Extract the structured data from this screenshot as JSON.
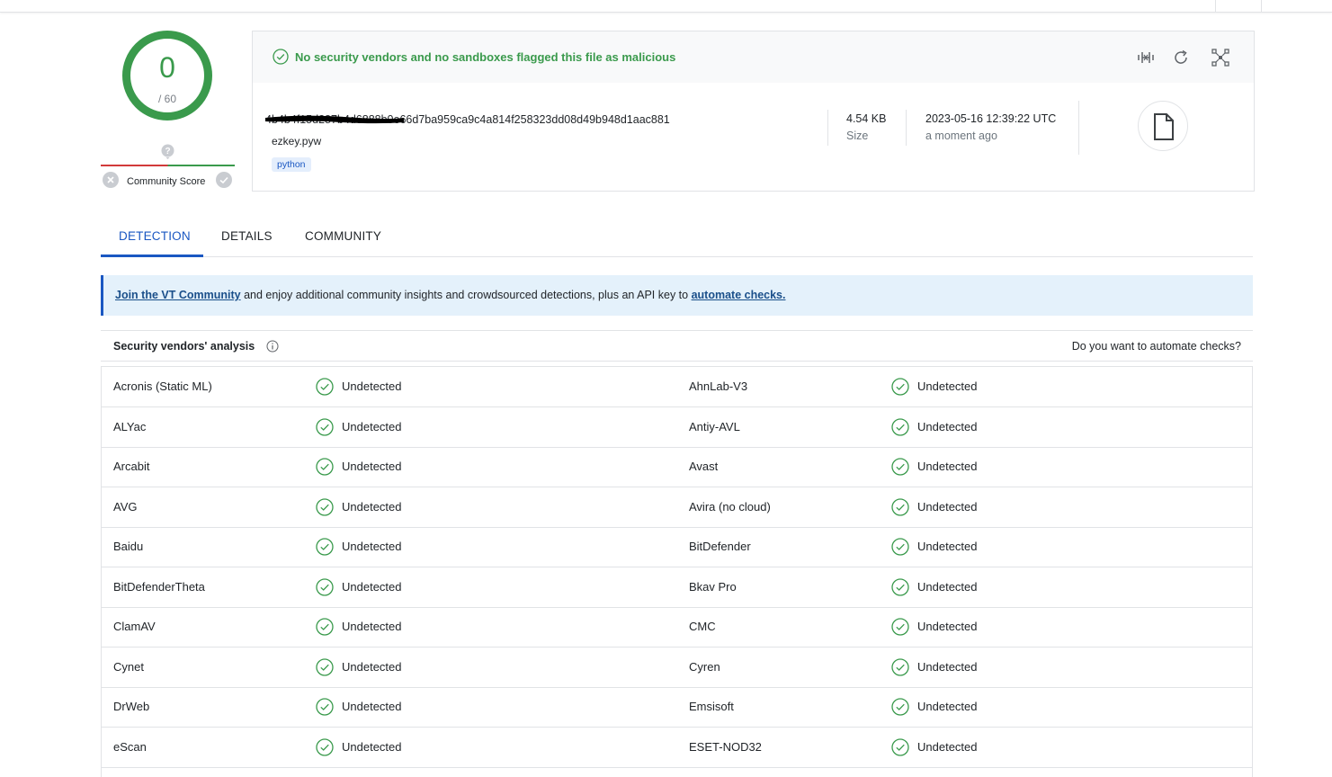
{
  "score": {
    "detections": "0",
    "total": "/ 60",
    "community_label": "Community Score"
  },
  "summary": {
    "flag_text": "No security vendors and no sandboxes flagged this file as malicious",
    "hash_visible": "4b4b4f15d287b4d6888b0e66d7ba959ca9c4a814f258323dd08d49b948d1aac881",
    "filename": "ezkey.pyw",
    "tag": "python",
    "size_value": "4.54 KB",
    "size_label": "Size",
    "date_value": "2023-05-16 12:39:22 UTC",
    "date_label": "a moment ago",
    "icons": [
      "compare-icon",
      "reanalyze-icon",
      "graph-icon",
      "file-icon"
    ]
  },
  "tabs": [
    "DETECTION",
    "DETAILS",
    "COMMUNITY"
  ],
  "banner": {
    "link1": "Join the VT Community",
    "middle": " and enjoy additional community insights and crowdsourced detections, plus an API key to ",
    "link2": "automate checks."
  },
  "analysis": {
    "title": "Security vendors' analysis",
    "automate_prompt": "Do you want to automate checks?"
  },
  "vendors": [
    {
      "left": "Acronis (Static ML)",
      "left_result": "Undetected",
      "right": "AhnLab-V3",
      "right_result": "Undetected"
    },
    {
      "left": "ALYac",
      "left_result": "Undetected",
      "right": "Antiy-AVL",
      "right_result": "Undetected"
    },
    {
      "left": "Arcabit",
      "left_result": "Undetected",
      "right": "Avast",
      "right_result": "Undetected"
    },
    {
      "left": "AVG",
      "left_result": "Undetected",
      "right": "Avira (no cloud)",
      "right_result": "Undetected"
    },
    {
      "left": "Baidu",
      "left_result": "Undetected",
      "right": "BitDefender",
      "right_result": "Undetected"
    },
    {
      "left": "BitDefenderTheta",
      "left_result": "Undetected",
      "right": "Bkav Pro",
      "right_result": "Undetected"
    },
    {
      "left": "ClamAV",
      "left_result": "Undetected",
      "right": "CMC",
      "right_result": "Undetected"
    },
    {
      "left": "Cynet",
      "left_result": "Undetected",
      "right": "Cyren",
      "right_result": "Undetected"
    },
    {
      "left": "DrWeb",
      "left_result": "Undetected",
      "right": "Emsisoft",
      "right_result": "Undetected"
    },
    {
      "left": "eScan",
      "left_result": "Undetected",
      "right": "ESET-NOD32",
      "right_result": "Undetected"
    }
  ],
  "colors": {
    "clean_green": "#3a9a4c",
    "accent_blue": "#1a57c2",
    "banner_bg": "#e4f1fb"
  }
}
